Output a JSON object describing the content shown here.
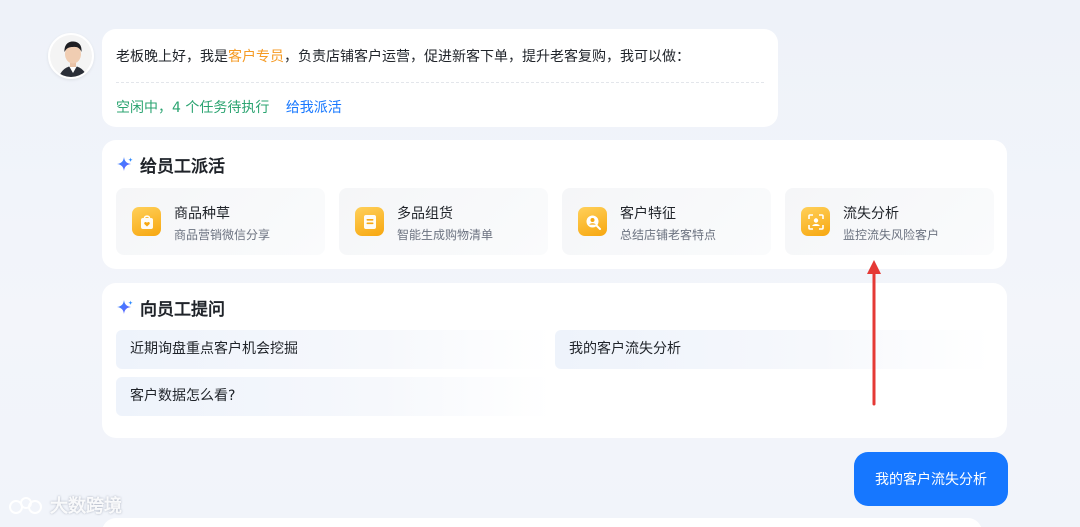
{
  "greeting": {
    "prefix": "老板晚上好，我是",
    "role": "客户专员",
    "suffix": "，负责店铺客户运营，促进新客下单，提升老客复购，我可以做：",
    "status": "空闲中，4 个任务待执行",
    "assign_link": "给我派活"
  },
  "assign_panel": {
    "title": "给员工派活",
    "tasks": [
      {
        "name": "商品种草",
        "desc": "商品营销微信分享",
        "icon": "heart-bag-icon"
      },
      {
        "name": "多品组货",
        "desc": "智能生成购物清单",
        "icon": "list-doc-icon"
      },
      {
        "name": "客户特征",
        "desc": "总结店铺老客特点",
        "icon": "user-search-icon"
      },
      {
        "name": "流失分析",
        "desc": "监控流失风险客户",
        "icon": "user-scan-icon"
      }
    ]
  },
  "ask_panel": {
    "title": "向员工提问",
    "questions": [
      "近期询盘重点客户机会挖掘",
      "我的客户流失分析",
      "客户数据怎么看?"
    ]
  },
  "user_message": "我的客户流失分析",
  "watermark": "大数跨境",
  "colors": {
    "accent_blue": "#1677ff",
    "status_green": "#2ba471",
    "highlight_orange": "#f59a23",
    "icon_orange": "#f7a70f",
    "arrow_red": "#e53935"
  }
}
